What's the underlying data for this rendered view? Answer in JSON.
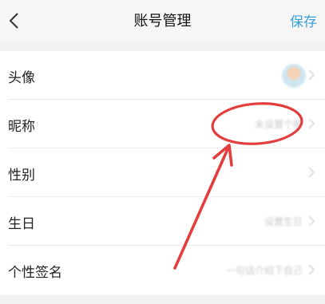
{
  "navbar": {
    "back_icon": "chevron-left-icon",
    "title": "账号管理",
    "save_label": "保存",
    "accent_color": "#3aa0d8"
  },
  "rows": [
    {
      "label": "头像",
      "value": "",
      "kind": "avatar"
    },
    {
      "label": "昵称",
      "value": "未设置个昵",
      "kind": "text"
    },
    {
      "label": "性别",
      "value": "",
      "kind": "text"
    },
    {
      "label": "生日",
      "value": "设置生日",
      "kind": "text"
    },
    {
      "label": "个性签名",
      "value": "一句话介绍下自己",
      "kind": "text"
    }
  ],
  "annotation": {
    "color": "#e43d3d",
    "shape": "ellipse-and-arrow"
  }
}
